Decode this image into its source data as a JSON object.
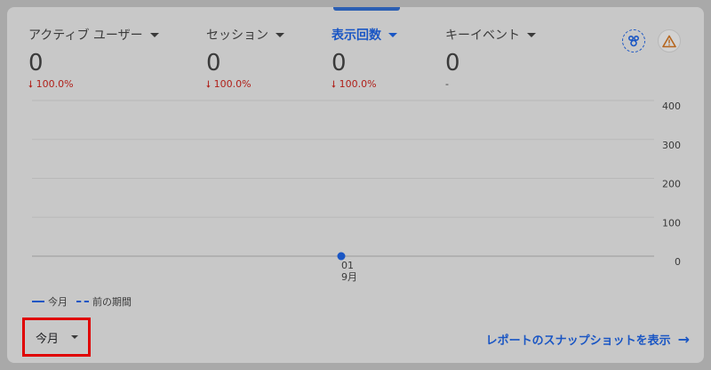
{
  "metrics": [
    {
      "label": "アクティブ ユーザー",
      "value": "0",
      "change": "100.0%",
      "direction": "down"
    },
    {
      "label": "セッション",
      "value": "0",
      "change": "100.0%",
      "direction": "down"
    },
    {
      "label": "表示回数",
      "value": "0",
      "change": "100.0%",
      "direction": "down",
      "selected": true
    },
    {
      "label": "キーイベント",
      "value": "0",
      "change": "-",
      "direction": "none"
    }
  ],
  "icons": {
    "insights": "insights-icon",
    "warning": "warning-icon"
  },
  "chart_data": {
    "type": "line",
    "y_ticks": [
      "400",
      "300",
      "200",
      "100",
      "0"
    ],
    "ylim": [
      0,
      400
    ],
    "x_tick": {
      "day": "01",
      "month": "9月"
    },
    "series": [
      {
        "name": "今月",
        "points": [
          {
            "x": "01 9月",
            "y": 0
          }
        ],
        "style": "solid"
      },
      {
        "name": "前の期間",
        "points": [],
        "style": "dashed"
      }
    ]
  },
  "legend": {
    "current": "今月",
    "previous": "前の期間"
  },
  "period_selector": {
    "value": "今月"
  },
  "report_link": {
    "label": "レポートのスナップショットを表示"
  },
  "colors": {
    "accent": "#1a56c4",
    "decrease": "#b0201a",
    "highlight_border": "#e00000"
  }
}
